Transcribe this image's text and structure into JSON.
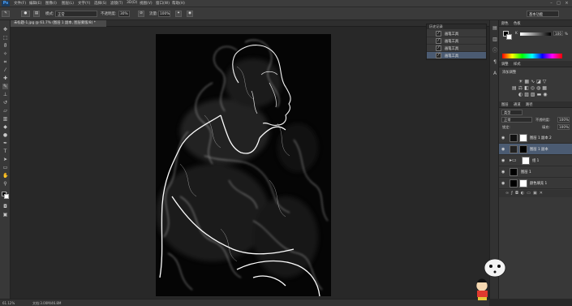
{
  "app": {
    "logo": "Ps"
  },
  "menu": [
    "文件(F)",
    "编辑(E)",
    "图像(I)",
    "图层(L)",
    "文字(Y)",
    "选择(S)",
    "滤镜(T)",
    "3D(D)",
    "视图(V)",
    "窗口(W)",
    "帮助(H)"
  ],
  "window_controls": {
    "minimize": "–",
    "maximize": "□",
    "close": "×"
  },
  "options": {
    "mode_label": "模式:",
    "mode_value": "正常",
    "opacity_label": "不透明度:",
    "opacity_value": "30%",
    "flow_label": "流量:",
    "flow_value": "100%",
    "workspace": "基本功能"
  },
  "document_tab": "未标题-1.jpg @ 61.7% (图层 1 副本, 图层蒙版/8) *",
  "status": {
    "zoom": "61.12%",
    "doc_size": "文档:3.00M/46.8M"
  },
  "history": {
    "title": "历史记录",
    "items": [
      {
        "label": "画笔工具",
        "selected": false
      },
      {
        "label": "画笔工具",
        "selected": false
      },
      {
        "label": "画笔工具",
        "selected": false
      },
      {
        "label": "画笔工具",
        "selected": true
      }
    ]
  },
  "color_panel": {
    "tabs": [
      "颜色",
      "色板"
    ],
    "channel": "K",
    "value": "100",
    "unit": "%"
  },
  "adjustments": {
    "tabs": [
      "调整",
      "样式"
    ],
    "title": "添加调整"
  },
  "layers_panel": {
    "tabs": [
      "图层",
      "通道",
      "路径"
    ],
    "kind_label": "类型",
    "blend_mode": "正常",
    "opacity_label": "不透明度:",
    "opacity_value": "100%",
    "lock_label": "锁定:",
    "fill_label": "填充:",
    "fill_value": "100%",
    "layers": [
      {
        "name": "图层 1 副本 2",
        "selected": false
      },
      {
        "name": "图层 1 副本",
        "selected": true
      },
      {
        "name": "组 1",
        "selected": false
      },
      {
        "name": "图层 1",
        "selected": false
      },
      {
        "name": "颜色填充 1",
        "selected": false
      }
    ]
  },
  "colors": {
    "accent": "#4b5b72",
    "background": "#282828",
    "panel": "#383838"
  }
}
